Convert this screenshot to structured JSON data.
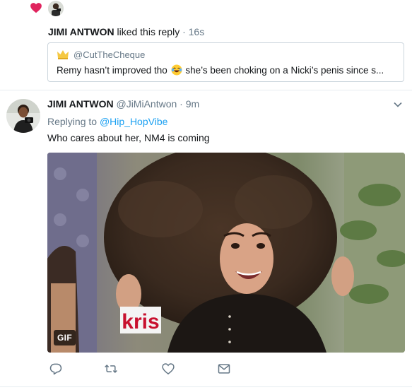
{
  "notification": {
    "user_name": "JIMI ANTWON",
    "action_text": "liked this reply",
    "separator": "·",
    "time": "16s",
    "icons": {
      "heart": "heart-icon",
      "avatar": "mini-avatar"
    },
    "colors": {
      "heart": "#e0245e"
    }
  },
  "quoted_tweet": {
    "handle": "@CutTheCheque",
    "text_before_emoji": "Remy hasn’t improved tho",
    "emoji": "face-with-tears-of-joy-emoji",
    "text_after_emoji": "she’s been choking on a Nicki’s penis since s..."
  },
  "tweet": {
    "user_name": "JIMI ANTWON",
    "handle": "@JiMiAntwon",
    "separator": "·",
    "time": "9m",
    "replying_to_label": "Replying to",
    "replying_to_handle": "@Hip_HopVibe",
    "text": "Who cares about her, NM4 is coming",
    "media": {
      "type": "gif",
      "badge": "GIF",
      "logo_text": "kris"
    }
  },
  "actions": [
    {
      "name": "reply",
      "icon": "reply-icon"
    },
    {
      "name": "retweet",
      "icon": "retweet-icon"
    },
    {
      "name": "like",
      "icon": "like-icon"
    },
    {
      "name": "direct-message",
      "icon": "envelope-icon"
    }
  ],
  "colors": {
    "link": "#1da1f2",
    "muted": "#657786",
    "text": "#14171a",
    "border": "#ccd6dd",
    "divider": "#e6ecf0"
  }
}
